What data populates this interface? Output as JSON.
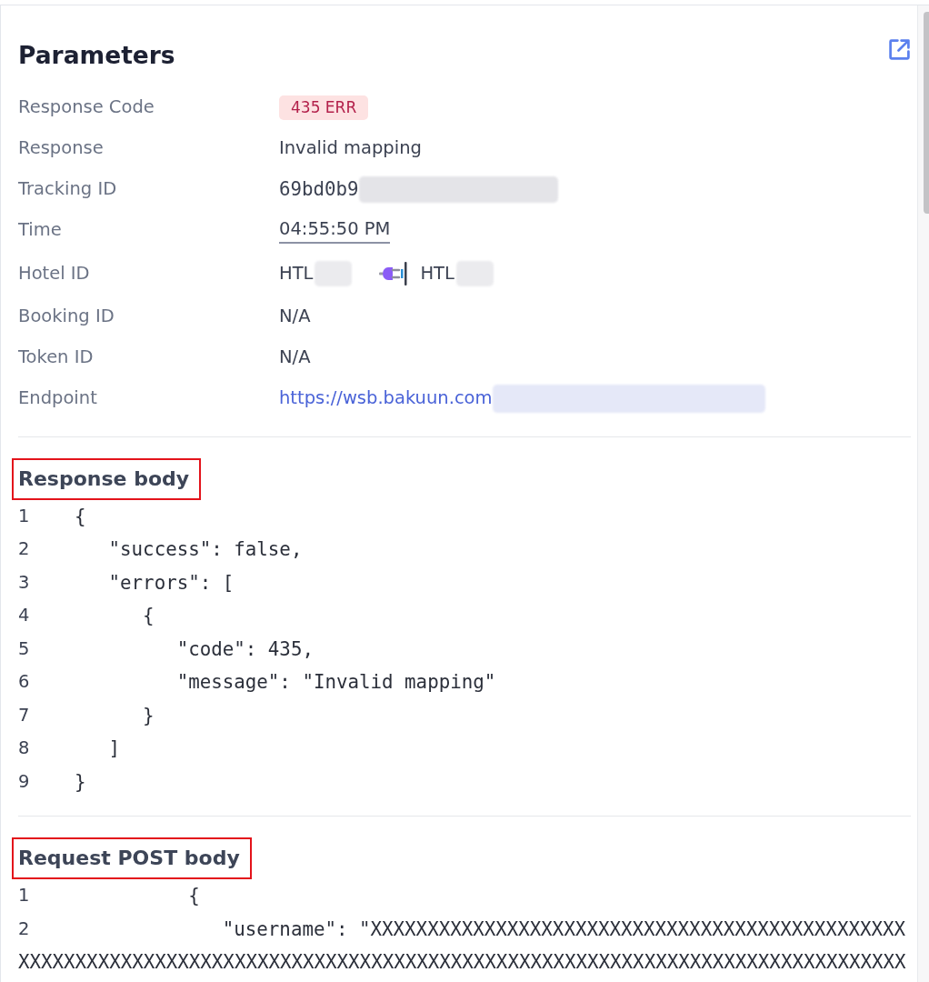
{
  "panel": {
    "title": "Parameters"
  },
  "parameters": [
    {
      "label": "Response Code",
      "kind": "badge",
      "value": "435 ERR"
    },
    {
      "label": "Response",
      "kind": "text",
      "value": "Invalid mapping"
    },
    {
      "label": "Tracking ID",
      "kind": "mono",
      "value": "69bd0b9",
      "redacted": true
    },
    {
      "label": "Time",
      "kind": "time",
      "value": "04:55:50 PM"
    },
    {
      "label": "Hotel ID",
      "kind": "mapping",
      "from": {
        "value": "HTL",
        "redacted": true
      },
      "to": {
        "value": "HTL",
        "redacted": true
      }
    },
    {
      "label": "Booking ID",
      "kind": "text",
      "value": "N/A"
    },
    {
      "label": "Token ID",
      "kind": "text",
      "value": "N/A"
    },
    {
      "label": "Endpoint",
      "kind": "link",
      "value": "https://wsb.bakuun.com",
      "redacted": true
    }
  ],
  "sections": [
    {
      "title": "Response body",
      "highlighted": true,
      "lines": [
        {
          "number": "1",
          "text": "{"
        },
        {
          "number": "2",
          "text": "   \"success\": false,"
        },
        {
          "number": "3",
          "text": "   \"errors\": ["
        },
        {
          "number": "4",
          "text": "      {"
        },
        {
          "number": "5",
          "text": "         \"code\": 435,"
        },
        {
          "number": "6",
          "text": "         \"message\": \"Invalid mapping\""
        },
        {
          "number": "7",
          "text": "      }"
        },
        {
          "number": "8",
          "text": "   ]"
        },
        {
          "number": "9",
          "text": "}"
        }
      ]
    },
    {
      "title": "Request POST body",
      "highlighted": true,
      "lines": [
        {
          "number": "1",
          "text": "          {"
        },
        {
          "number": "2",
          "text": "             \"username\": \"XXXXXXXXXXXXXXXXXXXXXXXXXXXXXXXXXXXXXXXXXXXXXXX",
          "continued": "XXXXXXXXXXXXXXXXXXXXXXXXXXXXXXXXXXXXXXXXXXXXXXXXXXXXXXXXXXXXXXXXXXXXXXXXXXXXXX"
        }
      ]
    }
  ]
}
